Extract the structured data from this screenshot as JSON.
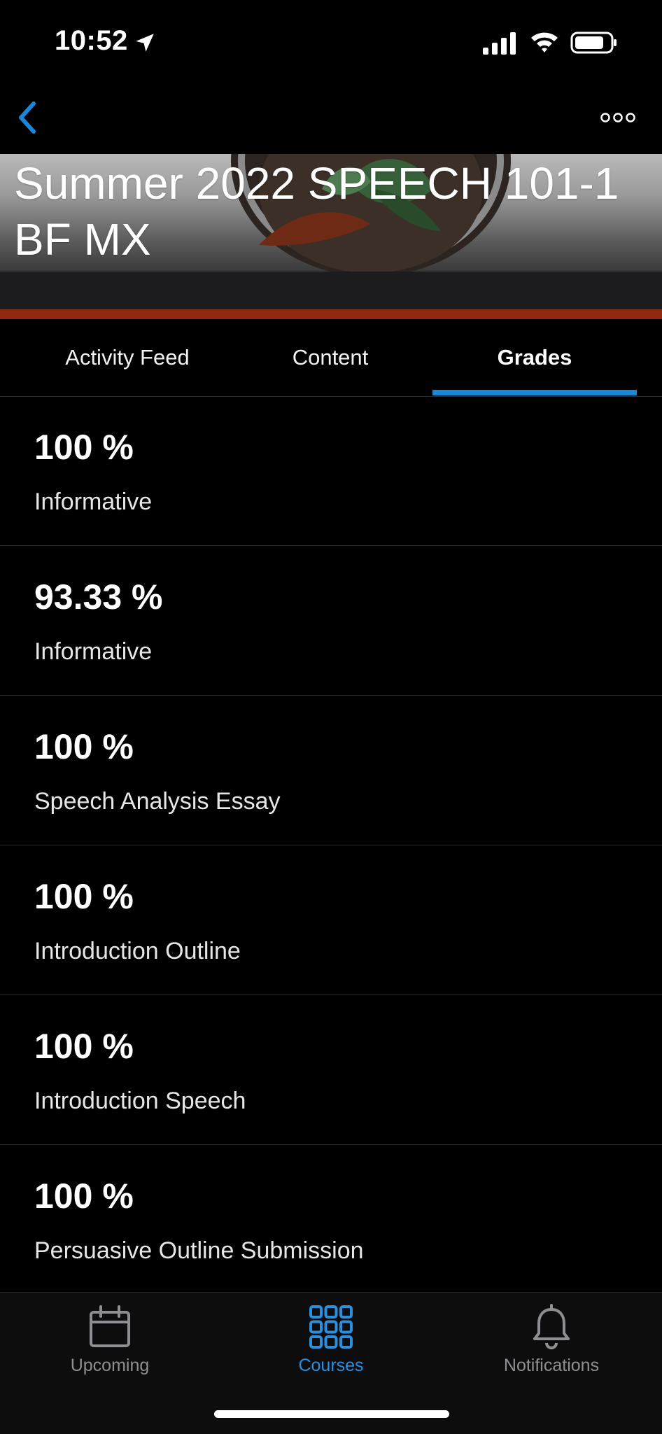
{
  "status_bar": {
    "time": "10:52"
  },
  "nav": {
    "back_icon": "chevron-left-icon",
    "more_icon": "ellipsis-icon"
  },
  "header": {
    "course_title": "Summer 2022 SPEECH 101-1 BF MX",
    "accent_color": "#8f2a0e"
  },
  "tabs": [
    {
      "label": "Activity Feed",
      "active": false
    },
    {
      "label": "Content",
      "active": false
    },
    {
      "label": "Grades",
      "active": true
    }
  ],
  "grades": [
    {
      "score": "100 %",
      "name": "Informative"
    },
    {
      "score": "93.33 %",
      "name": "Informative"
    },
    {
      "score": "100 %",
      "name": "Speech Analysis Essay"
    },
    {
      "score": "100 %",
      "name": "Introduction Outline"
    },
    {
      "score": "100 %",
      "name": "Introduction Speech"
    },
    {
      "score": "100 %",
      "name": "Persuasive Outline Submission"
    }
  ],
  "bottom_nav": [
    {
      "label": "Upcoming",
      "icon": "calendar-icon",
      "active": false
    },
    {
      "label": "Courses",
      "icon": "grid-icon",
      "active": true
    },
    {
      "label": "Notifications",
      "icon": "bell-icon",
      "active": false
    }
  ],
  "colors": {
    "tab_indicator": "#1c86d6",
    "active_bottom": "#2b8fe0",
    "inactive_bottom": "#8e8e93"
  }
}
